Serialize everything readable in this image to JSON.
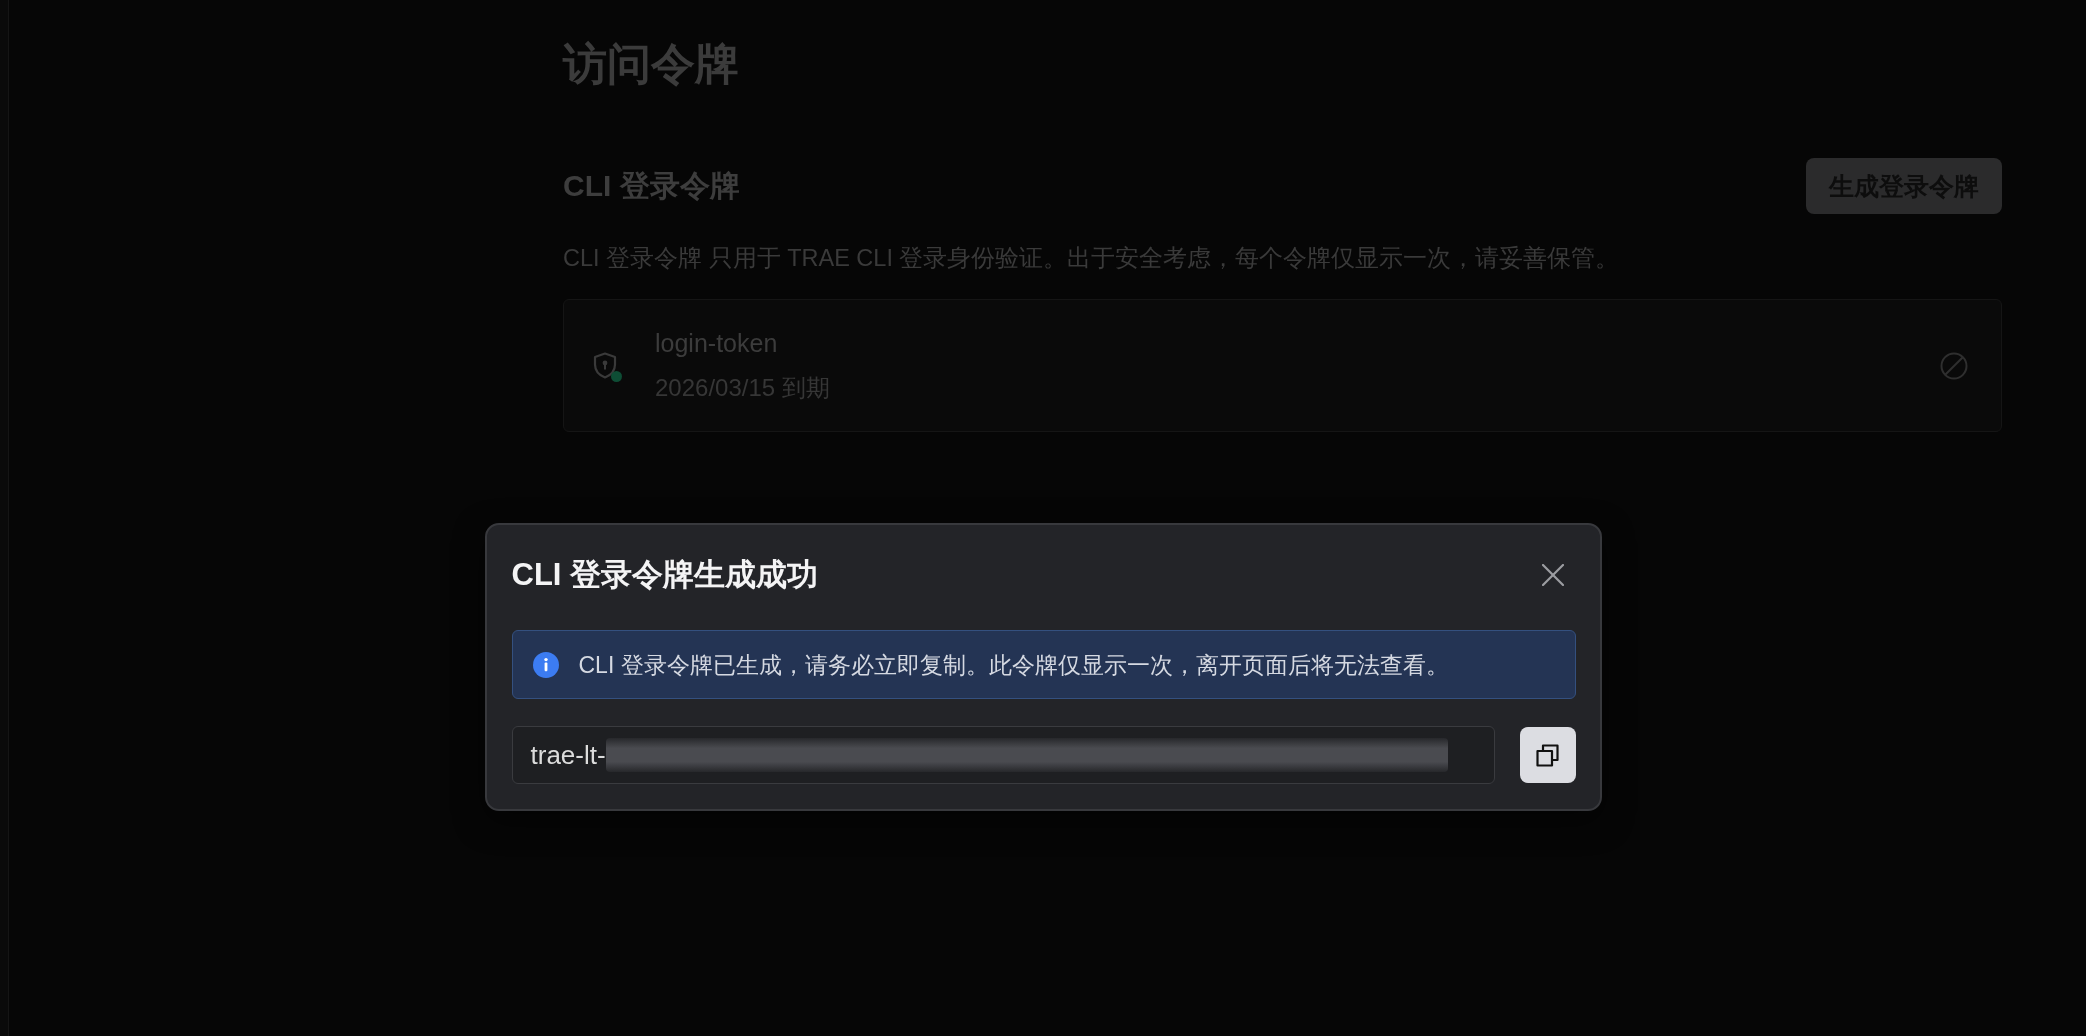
{
  "page": {
    "title": "访问令牌"
  },
  "section": {
    "title": "CLI 登录令牌",
    "button": "生成登录令牌",
    "description": "CLI 登录令牌 只用于 TRAE CLI 登录身份验证。出于安全考虑，每个令牌仅显示一次，请妥善保管。"
  },
  "tokens": [
    {
      "name": "login-token",
      "expiry": "2026/03/15 到期",
      "color": "#0e4d35"
    }
  ],
  "dialog": {
    "title": "CLI 登录令牌生成成功",
    "alert": {
      "kind": "info",
      "text": "CLI 登录令牌已生成，请务必立即复制。此令牌仅显示一次，离开页面后将无法查看。"
    },
    "token_field": {
      "value": "trae-lt-",
      "redacted": true
    }
  }
}
